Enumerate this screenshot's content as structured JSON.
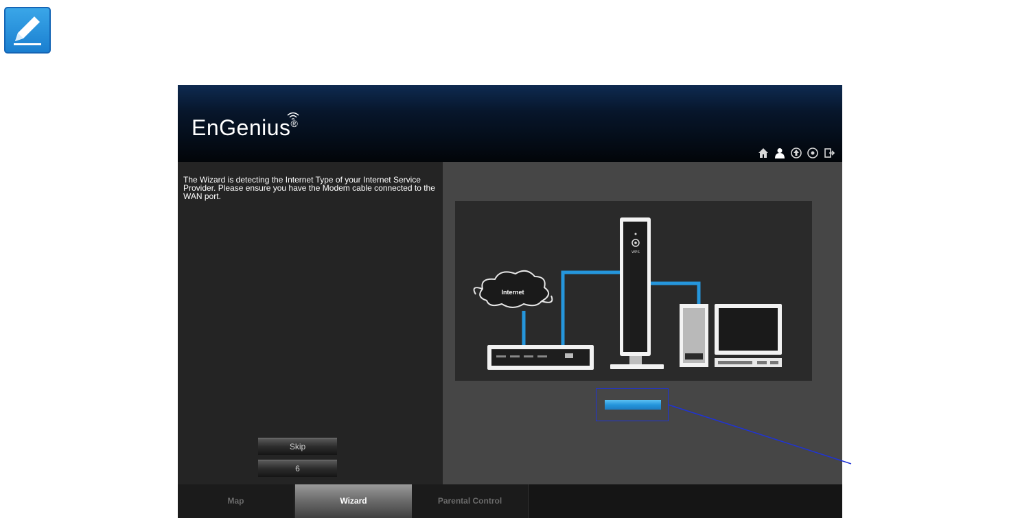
{
  "note_icon": "pencil-note-icon",
  "app": {
    "logo_text": "EnGenius",
    "logo_mark": "®",
    "header_icons": [
      "home-icon",
      "user-icon",
      "upgrade-icon",
      "settings-icon",
      "logout-icon"
    ]
  },
  "wizard": {
    "message": "The Wizard is detecting the Internet Type of your Internet Service Provider. Please ensure you have the Modem cable connected to the WAN port.",
    "skip_label": "Skip",
    "countdown": "6"
  },
  "diagram": {
    "cloud_label": "Internet",
    "router_wps_label": "WPS"
  },
  "progress_bar_fraction": 1.0,
  "tabs": [
    {
      "label": "Map",
      "active": false
    },
    {
      "label": "Wizard",
      "active": true
    },
    {
      "label": "Parental Control",
      "active": false
    }
  ],
  "colors": {
    "accent_blue": "#2596dc",
    "callout_blue": "#1f33d6",
    "header_dark": "#07162b"
  }
}
